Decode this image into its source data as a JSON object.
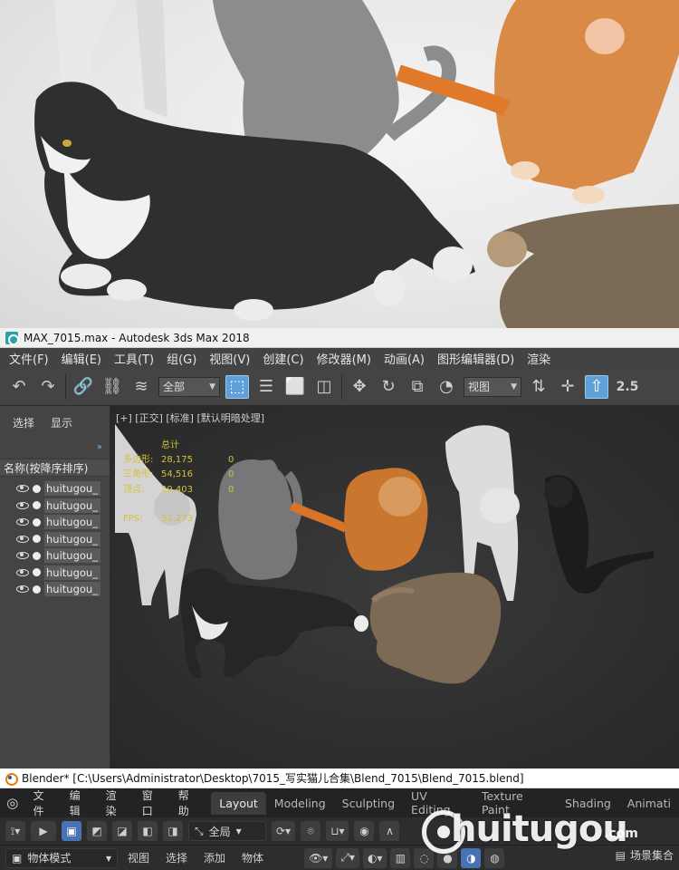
{
  "max": {
    "window_title": "MAX_7015.max - Autodesk 3ds Max 2018",
    "menu": [
      "文件(F)",
      "编辑(E)",
      "工具(T)",
      "组(G)",
      "视图(V)",
      "创建(C)",
      "修改器(M)",
      "动画(A)",
      "图形编辑器(D)",
      "渲染"
    ],
    "selection_filter": "全部",
    "ref_coord": "视图",
    "snap_label": "2.5",
    "left_tabs": [
      "选择",
      "显示"
    ],
    "scene_header": "名称(按降序排序)",
    "objects": [
      "huitugou_",
      "huitugou_",
      "huitugou_",
      "huitugou_",
      "huitugou_",
      "huitugou_",
      "huitugou_"
    ],
    "viewport_label": "[+] [正交] [标准] [默认明暗处理]",
    "stats": {
      "total_label": "总计",
      "rows": [
        {
          "k": "多边形:",
          "v": "28,175",
          "v2": "0"
        },
        {
          "k": "三角形:",
          "v": "54,516",
          "v2": "0"
        },
        {
          "k": "顶点:",
          "v": "29,403",
          "v2": "0"
        }
      ],
      "fps_label": "FPS:",
      "fps_value": "52.273"
    }
  },
  "blender": {
    "window_title": "Blender* [C:\\Users\\Administrator\\Desktop\\7015_写实猫儿合集\\Blend_7015\\Blend_7015.blend]",
    "menu": [
      "文件",
      "编辑",
      "渲染",
      "窗口",
      "帮助"
    ],
    "tabs": [
      "Layout",
      "Modeling",
      "Sculpting",
      "UV Editing",
      "Texture Paint",
      "Shading",
      "Animati"
    ],
    "active_tab": "Layout",
    "transform_orientation": "全局",
    "mode": "物体模式",
    "header_menu": [
      "视图",
      "选择",
      "添加",
      "物体"
    ],
    "scene_collection": "场景集合"
  },
  "watermark": {
    "text": "huitugou",
    "suffix": ".com"
  }
}
